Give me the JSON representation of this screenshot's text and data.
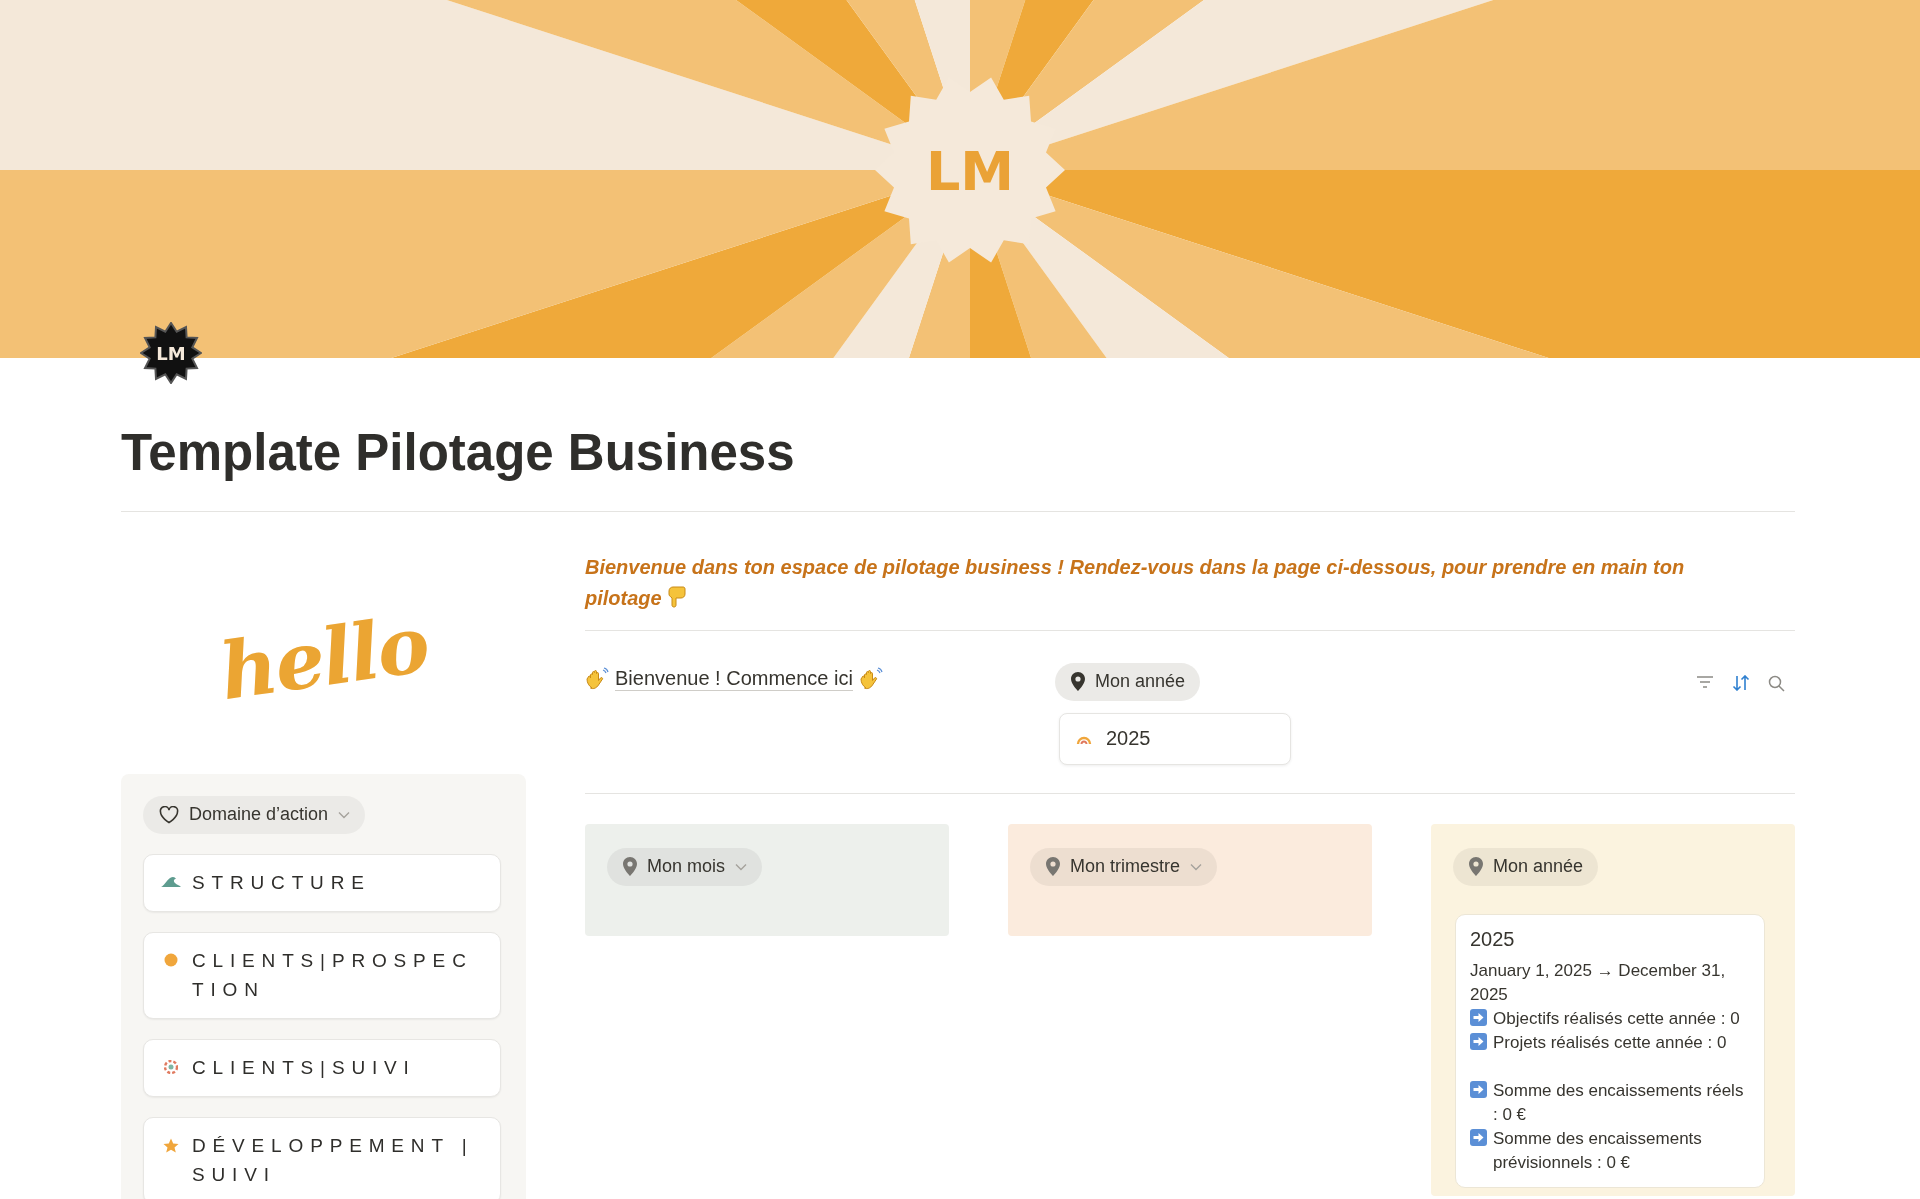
{
  "cover": {
    "logo_text": "LM"
  },
  "page_icon": {
    "text": "LM"
  },
  "title": "Template Pilotage Business",
  "sidebar": {
    "hello": "hello",
    "filter": {
      "label": "Domaine d’action"
    },
    "items": [
      {
        "label": "STRUCTURE",
        "color": "#5e9c8f"
      },
      {
        "label": "CLIENTS|PROSPECTION",
        "color": "#f0a63c"
      },
      {
        "label": "CLIENTS|SUIVI",
        "color": "#e07a5f"
      },
      {
        "label": "DÉVELOPPEMENT | SUIVI",
        "color": "#f0a63c"
      }
    ]
  },
  "intro": "Bienvenue dans ton espace de pilotage business ! Rendez-vous dans la page ci-dessous, pour prendre en main ton pilotage",
  "start_link": "Bienvenue ! Commence ici",
  "year_view": {
    "filter": {
      "label": "Mon année"
    },
    "card": {
      "title": "2025"
    }
  },
  "columns": [
    {
      "label": "Mon mois",
      "dropdown": true,
      "color": "#edf0ec"
    },
    {
      "label": "Mon trimestre",
      "dropdown": true,
      "color": "#fbebdd"
    },
    {
      "label": "Mon année",
      "dropdown": false,
      "color": "#fbf3df",
      "card": {
        "title": "2025",
        "dates": "January 1, 2025 → December 31, 2025",
        "groups": [
          [
            "Objectifs réalisés cette année : 0",
            "Projets réalisés cette année : 0"
          ],
          [
            "Somme des encaissements réels : 0 €",
            "Somme des encaissements prévisionnels : 0 €"
          ]
        ]
      }
    }
  ]
}
